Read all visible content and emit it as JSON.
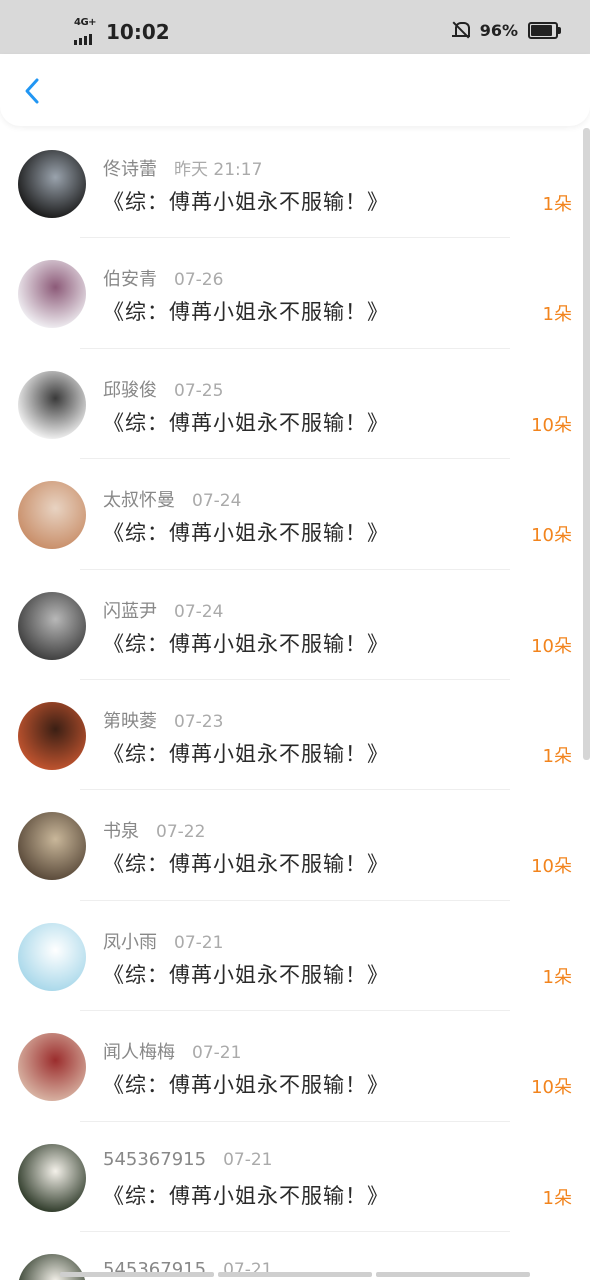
{
  "status_bar": {
    "network": "4G+",
    "time": "10:02",
    "battery_percent": "96%"
  },
  "header": {
    "back_icon": "chevron-left-icon"
  },
  "records": [
    {
      "name": "佟诗蕾",
      "date": "昨天 21:17",
      "title": "《综：傅苒小姐永不服输！》",
      "amount": "1朵",
      "avatar_colors": [
        "#1b1b1b",
        "#9aa3ad"
      ]
    },
    {
      "name": "伯安青",
      "date": "07-26",
      "title": "《综：傅苒小姐永不服输！》",
      "amount": "1朵",
      "avatar_colors": [
        "#f0eef2",
        "#8c5a78"
      ]
    },
    {
      "name": "邱骏俊",
      "date": "07-25",
      "title": "《综：傅苒小姐永不服输！》",
      "amount": "10朵",
      "avatar_colors": [
        "#f2f2f2",
        "#3a3a3a"
      ]
    },
    {
      "name": "太叔怀曼",
      "date": "07-24",
      "title": "《综：傅苒小姐永不服输！》",
      "amount": "10朵",
      "avatar_colors": [
        "#c98f6a",
        "#e8d3c2"
      ]
    },
    {
      "name": "闪蓝尹",
      "date": "07-24",
      "title": "《综：傅苒小姐永不服输！》",
      "amount": "10朵",
      "avatar_colors": [
        "#3f3f3f",
        "#b8b8b8"
      ]
    },
    {
      "name": "第映菱",
      "date": "07-23",
      "title": "《综：傅苒小姐永不服输！》",
      "amount": "1朵",
      "avatar_colors": [
        "#c0542f",
        "#3b1f14"
      ]
    },
    {
      "name": "书泉",
      "date": "07-22",
      "title": "《综：傅苒小姐永不服输！》",
      "amount": "10朵",
      "avatar_colors": [
        "#5a4a3a",
        "#c9b79a"
      ]
    },
    {
      "name": "凤小雨",
      "date": "07-21",
      "title": "《综：傅苒小姐永不服输！》",
      "amount": "1朵",
      "avatar_colors": [
        "#a9d8ea",
        "#ffffff"
      ]
    },
    {
      "name": "闻人梅梅",
      "date": "07-21",
      "title": "《综：傅苒小姐永不服输！》",
      "amount": "10朵",
      "avatar_colors": [
        "#d8b3a3",
        "#9b2d2d"
      ]
    },
    {
      "name": "545367915",
      "date": "07-21",
      "title": "《综：傅苒小姐永不服输！》",
      "amount": "1朵",
      "avatar_colors": [
        "#2f3b2a",
        "#f4f1ea"
      ]
    },
    {
      "name": "545367915",
      "date": "07-21",
      "title": "",
      "amount": "",
      "avatar_colors": [
        "#2f3b2a",
        "#f4f1ea"
      ]
    }
  ],
  "colors": {
    "accent": "#2196f3",
    "amount": "#f2841d",
    "name": "#888888",
    "date": "#aaaaaa",
    "title": "#2a2a2a"
  }
}
